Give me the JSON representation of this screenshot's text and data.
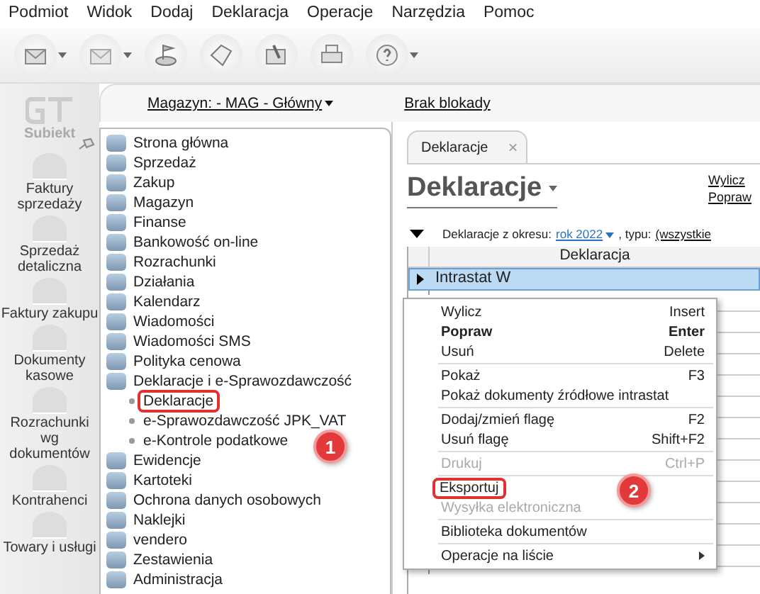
{
  "menu_bar": [
    "Podmiot",
    "Widok",
    "Dodaj",
    "Deklaracja",
    "Operacje",
    "Narzędzia",
    "Pomoc"
  ],
  "toolbar": [
    {
      "kind": "envelope-out",
      "dropdown": true
    },
    {
      "kind": "envelope-in",
      "dropdown": true
    },
    {
      "kind": "coins",
      "dropdown": false
    },
    {
      "kind": "tag",
      "dropdown": false
    },
    {
      "kind": "broom",
      "dropdown": false
    },
    {
      "kind": "printer",
      "dropdown": false
    },
    {
      "kind": "help",
      "dropdown": true
    }
  ],
  "sidebar": {
    "logo": "Subiekt",
    "items": [
      {
        "label": "Faktury sprzedaży"
      },
      {
        "label": "Sprzedaż detaliczna"
      },
      {
        "label": "Faktury zakupu"
      },
      {
        "label": "Dokumenty kasowe"
      },
      {
        "label": "Rozrachunki wg dokumentów"
      },
      {
        "label": "Kontrahenci"
      },
      {
        "label": "Towary i usługi"
      }
    ]
  },
  "top_strip": {
    "warehouse": "Magazyn: - MAG - Główny",
    "lock": "Brak blokady"
  },
  "tree": [
    {
      "label": "Strona główna"
    },
    {
      "label": "Sprzedaż"
    },
    {
      "label": "Zakup"
    },
    {
      "label": "Magazyn"
    },
    {
      "label": "Finanse"
    },
    {
      "label": "Bankowość on-line"
    },
    {
      "label": "Rozrachunki"
    },
    {
      "label": "Działania"
    },
    {
      "label": "Kalendarz"
    },
    {
      "label": "Wiadomości"
    },
    {
      "label": "Wiadomości SMS"
    },
    {
      "label": "Polityka cenowa"
    },
    {
      "label": "Deklaracje i e-Sprawozdawczość",
      "children": [
        {
          "label": "Deklaracje",
          "highlighted": true
        },
        {
          "label": "e-Sprawozdawczość JPK_VAT",
          "highlighted": false
        },
        {
          "label": "e-Kontrole podatkowe",
          "highlighted": false
        }
      ]
    },
    {
      "label": "Ewidencje"
    },
    {
      "label": "Kartoteki"
    },
    {
      "label": "Ochrona danych osobowych"
    },
    {
      "label": "Naklejki"
    },
    {
      "label": "vendero"
    },
    {
      "label": "Zestawienia"
    },
    {
      "label": "Administracja"
    }
  ],
  "tab": {
    "label": "Deklaracje",
    "close": "×"
  },
  "heading": "Deklaracje",
  "actions": [
    "Wylicz",
    "Popraw"
  ],
  "filter": {
    "label": "Deklaracje z okresu:",
    "period": "rok 2022",
    "type_label": ", typu:",
    "type": "(wszystkie"
  },
  "table": {
    "columns": [
      "Deklaracja"
    ],
    "rows": [
      {
        "name": "Intrastat W",
        "selected": true
      }
    ]
  },
  "context_menu": [
    {
      "kind": "item",
      "label": "Wylicz",
      "shortcut": "Insert",
      "bold": false,
      "disabled": false,
      "highlighted": false
    },
    {
      "kind": "item",
      "label": "Popraw",
      "shortcut": "Enter",
      "bold": true,
      "disabled": false,
      "highlighted": false
    },
    {
      "kind": "item",
      "label": "Usuń",
      "shortcut": "Delete",
      "bold": false,
      "disabled": false,
      "highlighted": false
    },
    {
      "kind": "separator"
    },
    {
      "kind": "item",
      "label": "Pokaż",
      "shortcut": "F3",
      "bold": false,
      "disabled": false,
      "highlighted": false
    },
    {
      "kind": "item",
      "label": "Pokaż dokumenty źródłowe intrastat",
      "bold": false,
      "disabled": false,
      "highlighted": false
    },
    {
      "kind": "separator"
    },
    {
      "kind": "item",
      "label": "Dodaj/zmień flagę",
      "shortcut": "F2",
      "bold": false,
      "disabled": false,
      "highlighted": false
    },
    {
      "kind": "item",
      "label": "Usuń flagę",
      "shortcut": "Shift+F2",
      "bold": false,
      "disabled": false,
      "highlighted": false
    },
    {
      "kind": "separator"
    },
    {
      "kind": "item",
      "label": "Drukuj",
      "shortcut": "Ctrl+P",
      "bold": false,
      "disabled": true,
      "highlighted": false
    },
    {
      "kind": "separator"
    },
    {
      "kind": "item",
      "label": "Eksportuj",
      "bold": false,
      "disabled": false,
      "highlighted": true
    },
    {
      "kind": "item",
      "label": "Wysyłka elektroniczna",
      "bold": false,
      "disabled": true,
      "highlighted": false
    },
    {
      "kind": "separator"
    },
    {
      "kind": "item",
      "label": "Biblioteka dokumentów",
      "bold": false,
      "disabled": false,
      "highlighted": false
    },
    {
      "kind": "separator"
    },
    {
      "kind": "submenu",
      "label": "Operacje na liście",
      "bold": false,
      "disabled": false,
      "highlighted": false
    }
  ],
  "step_badges": [
    "1",
    "2"
  ]
}
